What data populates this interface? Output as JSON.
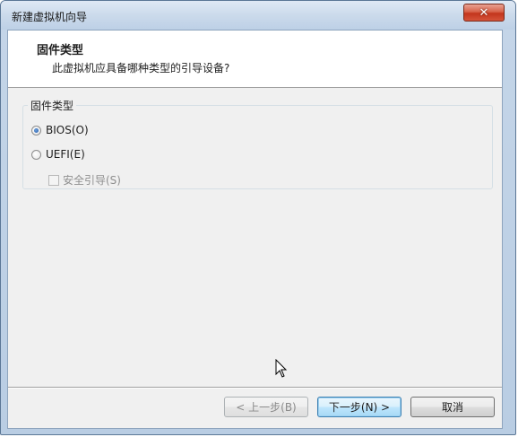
{
  "window": {
    "title": "新建虚拟机向导",
    "close_label": "✕"
  },
  "header": {
    "title": "固件类型",
    "subtitle": "此虚拟机应具备哪种类型的引导设备?"
  },
  "firmware_group": {
    "legend": "固件类型",
    "options": [
      {
        "label": "BIOS(O)",
        "selected": true
      },
      {
        "label": "UEFI(E)",
        "selected": false
      }
    ],
    "secure_boot": {
      "label": "安全引导(S)",
      "checked": false,
      "enabled": false
    }
  },
  "buttons": {
    "back": "< 上一步(B)",
    "next": "下一步(N) >",
    "cancel": "取消"
  },
  "icons": {
    "close": "close-icon",
    "cursor": "mouse-pointer-icon"
  }
}
